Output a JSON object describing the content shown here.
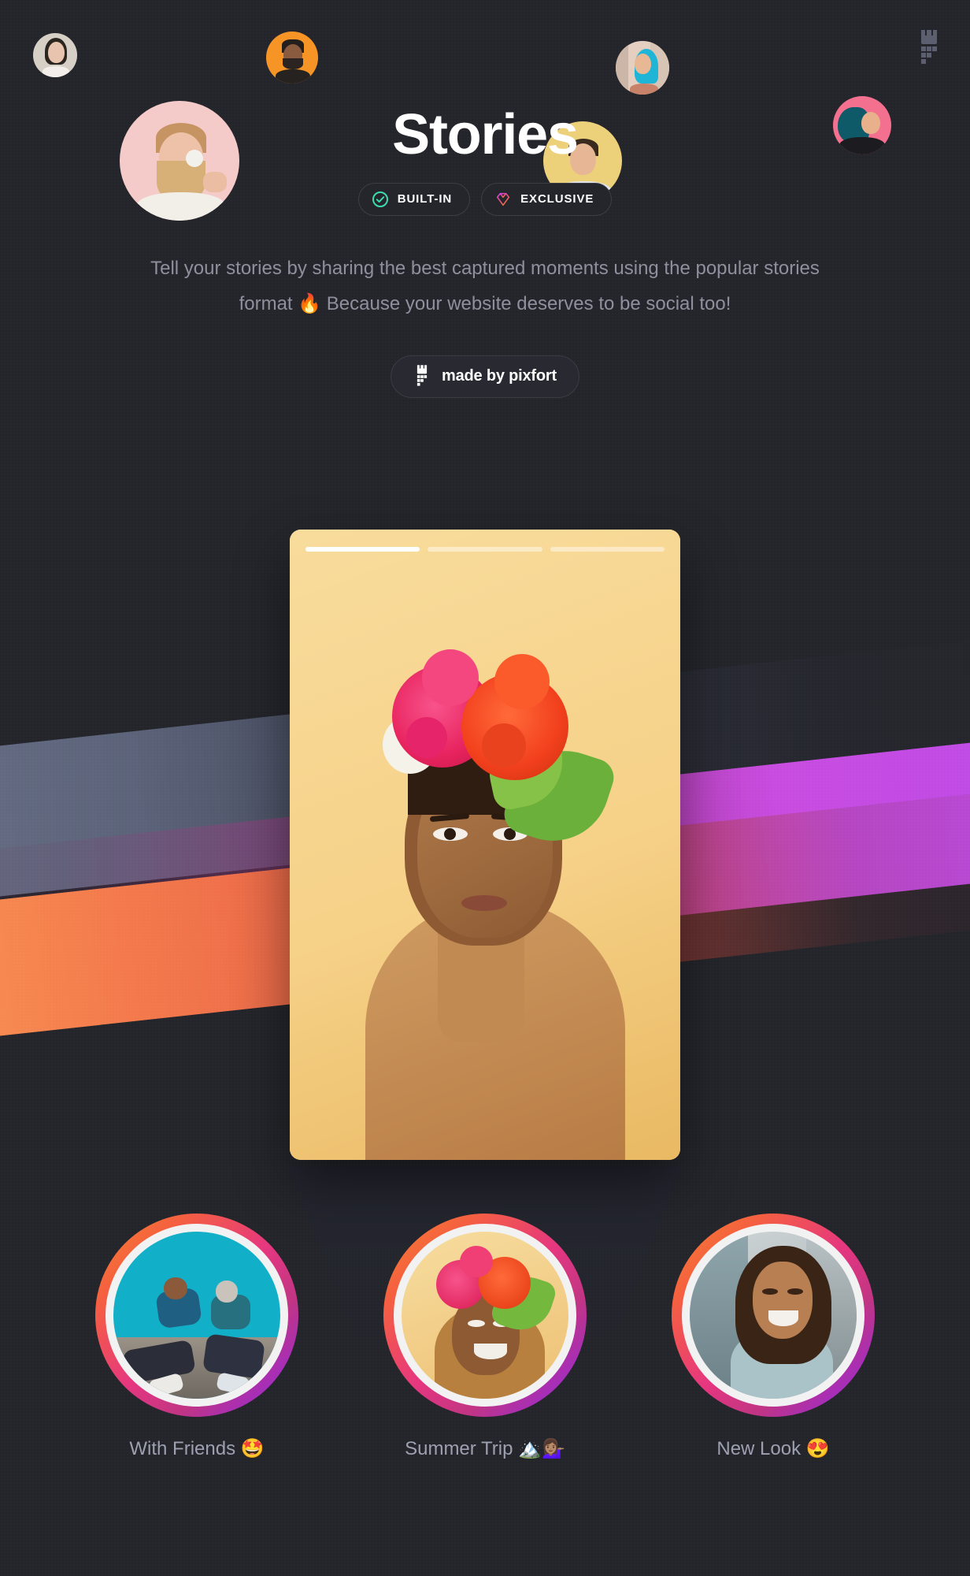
{
  "brand": {
    "logo_icon": "pixfort-castle-logo",
    "accent_teal": "#3ddcb0",
    "accent_pink": "#f2487d",
    "accent_purple": "#bb4ae8",
    "accent_orange": "#f47b4c",
    "background": "#24252b",
    "text_muted": "#8e909d"
  },
  "header": {
    "title": "Stories",
    "badges": [
      {
        "label": "BUILT-IN",
        "icon": "check-circle-icon"
      },
      {
        "label": "EXCLUSIVE",
        "icon": "diamond-icon"
      }
    ],
    "description": "Tell your stories by sharing the best captured moments using the popular stories format 🔥 Because your website deserves to be social too!",
    "made_by_label": "made by pixfort",
    "made_by_icon": "pixfort-castle-logo"
  },
  "floating_avatars": [
    {
      "name": "avatar-woman-beige",
      "bg": "#d6cfc6"
    },
    {
      "name": "avatar-man-orange",
      "bg": "#f79426"
    },
    {
      "name": "avatar-man-beard-pink",
      "bg": "#f4cbc9"
    },
    {
      "name": "avatar-woman-bluehair",
      "bg": "#e8d3c6"
    },
    {
      "name": "avatar-man-yellow",
      "bg": "#ecd07a"
    },
    {
      "name": "avatar-woman-pink",
      "bg": "#f4708f"
    }
  ],
  "story_card": {
    "name": "active-story-card",
    "background": "#f6d28a",
    "progress": [
      {
        "state": "active"
      },
      {
        "state": "inactive"
      },
      {
        "state": "inactive"
      }
    ]
  },
  "story_circles": [
    {
      "label": "With Friends 🤩",
      "name": "story-with-friends"
    },
    {
      "label": "Summer Trip 🏔️💁🏽‍♀️",
      "name": "story-summer-trip"
    },
    {
      "label": "New Look 😍",
      "name": "story-new-look"
    }
  ]
}
